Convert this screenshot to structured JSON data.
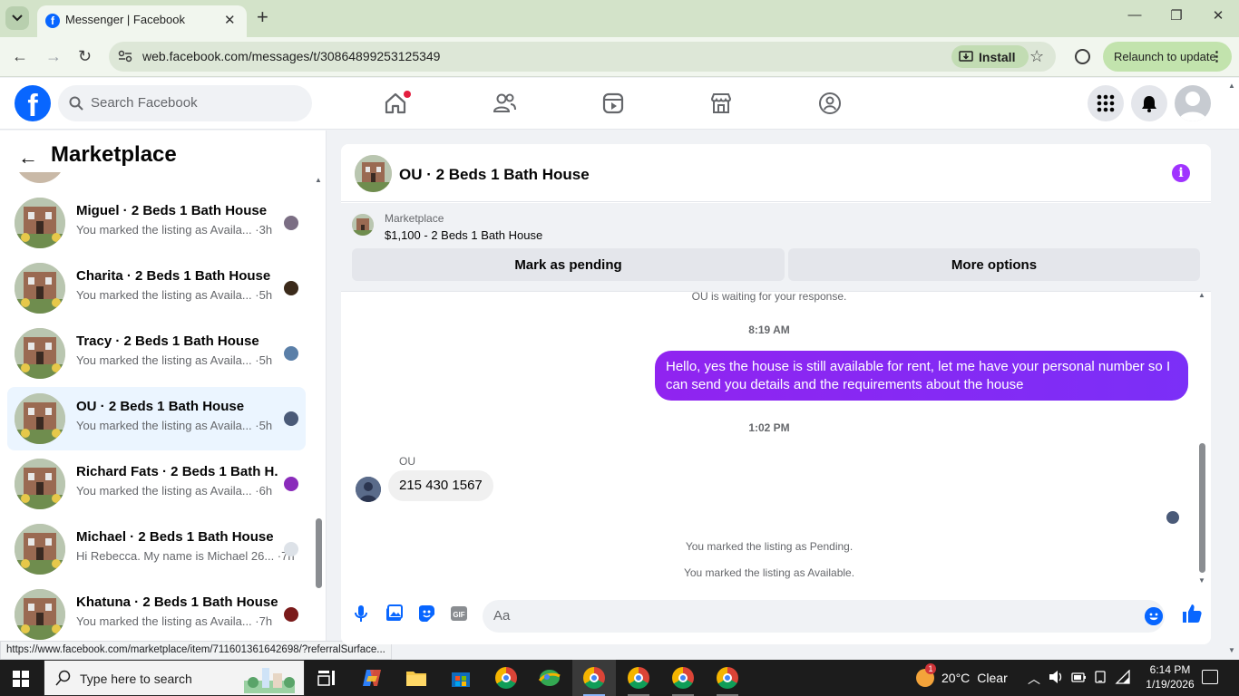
{
  "browser": {
    "tab_title": "Messenger | Facebook",
    "url": "web.facebook.com/messages/t/30864899253125349",
    "install_label": "Install",
    "relaunch_label": "Relaunch to update",
    "status_url": "https://www.facebook.com/marketplace/item/711601361642698/?referralSurface..."
  },
  "fb": {
    "search_placeholder": "Search Facebook"
  },
  "left": {
    "back_icon": "arrow-left-icon",
    "title": "Marketplace",
    "conversations": [
      {
        "name": "Miguel · 2 Beds 1 Bath House",
        "preview": "You marked the listing as Availa... ·3h",
        "active": false
      },
      {
        "name": "Charita · 2 Beds 1 Bath House",
        "preview": "You marked the listing as Availa... ·5h",
        "active": false
      },
      {
        "name": "Tracy · 2 Beds 1 Bath House",
        "preview": "You marked the listing as Availa... ·5h",
        "active": false
      },
      {
        "name": "OU · 2 Beds 1 Bath House",
        "preview": "You marked the listing as Availa... ·5h",
        "active": true
      },
      {
        "name": "Richard Fats · 2 Beds 1 Bath H...",
        "preview": "You marked the listing as Availa... ·6h",
        "active": false
      },
      {
        "name": "Michael · 2 Beds 1 Bath House",
        "preview": "Hi Rebecca. My name is Michael 26... ·7h",
        "active": false
      },
      {
        "name": "Khatuna · 2 Beds 1 Bath House",
        "preview": "You marked the listing as Availa... ·7h",
        "active": false
      }
    ]
  },
  "chat": {
    "title": "OU · 2 Beds 1 Bath House",
    "listing_source": "Marketplace",
    "listing_desc": "$1,100 - 2 Beds 1 Bath House",
    "mark_pending_label": "Mark as pending",
    "more_options_label": "More options",
    "waiting_text": "OU is waiting for your response.",
    "time1": "8:19 AM",
    "outgoing_message": "Hello, yes the house is still available for rent, let me have your personal number so I can send you details and the requirements about the house",
    "time2": "1:02 PM",
    "sender_name": "OU",
    "incoming_message": "215 430 1567",
    "sys_pending": "You marked the listing as Pending.",
    "sys_available": "You marked the listing as Available.",
    "input_placeholder": "Aa"
  },
  "taskbar": {
    "search_placeholder": "Type here to search",
    "weather_temp": "20°C",
    "weather_desc": "Clear",
    "weather_badge": "1",
    "time": "6:14 PM",
    "date": "1/19/2026"
  },
  "colors": {
    "fb_blue": "#0866ff",
    "messenger_purple": "#8a2be2",
    "active_conv_bg": "#ebf5ff"
  }
}
